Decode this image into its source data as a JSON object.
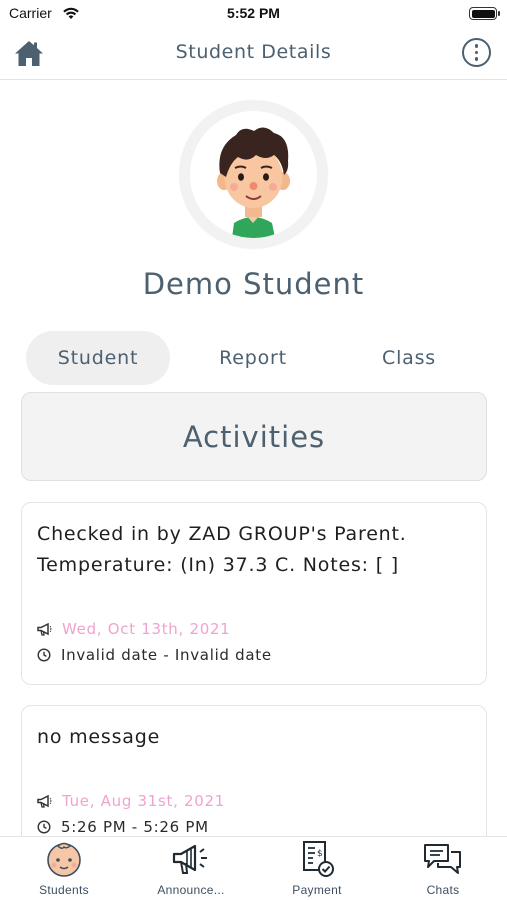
{
  "status_bar": {
    "carrier": "Carrier",
    "time": "5:52 PM"
  },
  "header": {
    "title": "Student Details",
    "home_icon": "home-icon",
    "menu_icon": "more-vertical-icon"
  },
  "student": {
    "name": "Demo Student",
    "avatar_icon": "boy-avatar"
  },
  "tabs": [
    {
      "label": "Student",
      "active": true
    },
    {
      "label": "Report",
      "active": false
    },
    {
      "label": "Class",
      "active": false
    }
  ],
  "section_title": "Activities",
  "activities": [
    {
      "message": "Checked in by ZAD GROUP's Parent. Temperature: (In) 37.3 C. Notes: [ ]",
      "date": "Wed, Oct 13th, 2021",
      "time_range": "Invalid date - Invalid date"
    },
    {
      "message": "no message",
      "date": "Tue, Aug 31st, 2021",
      "time_range": "5:26 PM - 5:26 PM"
    }
  ],
  "bottom_nav": [
    {
      "label": "Students",
      "icon": "baby-face-icon"
    },
    {
      "label": "Announce...",
      "icon": "megaphone-icon"
    },
    {
      "label": "Payment",
      "icon": "receipt-icon"
    },
    {
      "label": "Chats",
      "icon": "chat-bubbles-icon"
    }
  ],
  "colors": {
    "primary_text": "#4c6070",
    "date_pink": "#f0a3cf",
    "active_tab_bg": "#efefef"
  }
}
